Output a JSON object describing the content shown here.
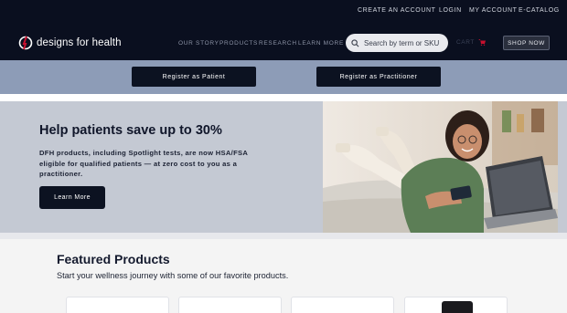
{
  "utility_nav": {
    "create_account": "CREATE AN ACCOUNT",
    "login": "LOGIN",
    "my_account": "MY ACCOUNT",
    "ecatalog": "E-CATALOG"
  },
  "brand": {
    "name": "designs for health",
    "logo_icon": "dfh-logo-icon"
  },
  "main_nav": {
    "items": [
      "OUR STORY",
      "PRODUCTS",
      "RESEARCH",
      "LEARN MORE"
    ]
  },
  "search": {
    "placeholder": "Search by term or SKU",
    "icon": "search-icon"
  },
  "cart": {
    "label": "CART",
    "icon": "cart-icon"
  },
  "shop_now": "SHOP NOW",
  "register": {
    "patient": "Register as Patient",
    "practitioner": "Register as Practitioner"
  },
  "hero": {
    "title": "Help patients save up to 30%",
    "body": "DFH products, including Spotlight tests, are now HSA/FSA eligible for qualified patients — at zero cost to you as a practitioner.",
    "cta": "Learn More"
  },
  "featured": {
    "title": "Featured Products",
    "subtitle": "Start your wellness journey with some of our favorite products."
  },
  "colors": {
    "nav_bg": "#0a0f1f",
    "register_strip": "#8d9cb7",
    "hero_bg": "#c4c9d3",
    "button_dark": "#0c1221",
    "accent_red": "#c8102e"
  }
}
